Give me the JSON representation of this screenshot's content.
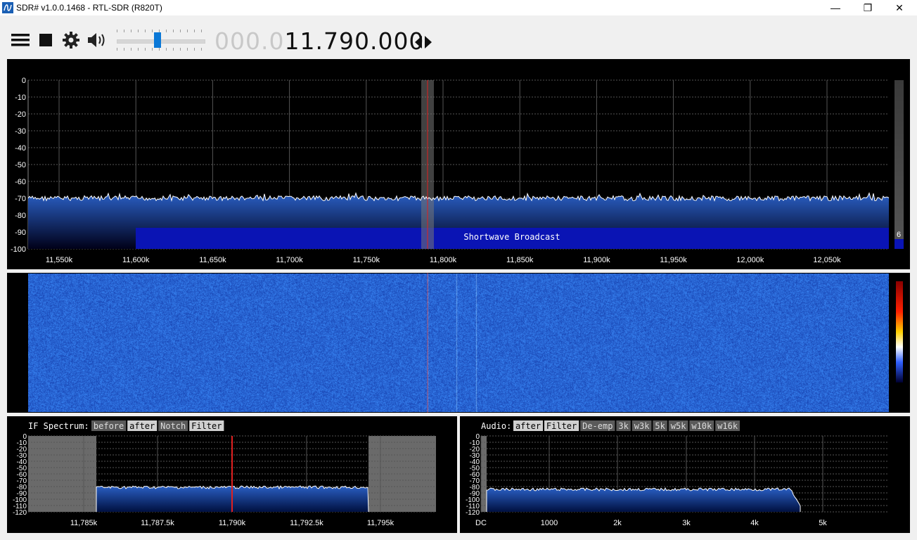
{
  "window": {
    "title": "SDR# v1.0.0.1468 - RTL-SDR (R820T)",
    "minimize": "—",
    "maximize": "❐",
    "close": "✕"
  },
  "toolbar": {
    "menu_icon": "hamburger-menu-icon",
    "stop_icon": "stop-square-icon",
    "settings_icon": "gear-icon",
    "audio_icon": "speaker-icon",
    "volume_level": 0.47,
    "freq_dim": "000.0",
    "freq_lit": "11.790.000",
    "tune_arrows_icon": "left-right-arrows-icon"
  },
  "spectrum": {
    "y_ticks": [
      "0",
      "-10",
      "-20",
      "-30",
      "-40",
      "-50",
      "-60",
      "-70",
      "-80",
      "-90",
      "-100"
    ],
    "x_ticks": [
      "11,550k",
      "11,600k",
      "11,650k",
      "11,700k",
      "11,750k",
      "11,800k",
      "11,850k",
      "11,900k",
      "11,950k",
      "12,000k",
      "12,050k"
    ],
    "band_label": "Shortwave Broadcast",
    "gain_value": "6",
    "noise_floor_db": -70
  },
  "if_spectrum": {
    "label": "IF Spectrum:",
    "buttons": [
      "before",
      "after",
      "Notch",
      "Filter"
    ],
    "y_ticks": [
      "0",
      "-10",
      "-20",
      "-30",
      "-40",
      "-50",
      "-60",
      "-70",
      "-80",
      "-90",
      "-100",
      "-110",
      "-120"
    ],
    "x_ticks": [
      "11,785k",
      "11,787.5k",
      "11,790k",
      "11,792.5k",
      "11,795k"
    ]
  },
  "audio": {
    "label": "Audio:",
    "buttons": [
      "after",
      "Filter",
      "De-emp",
      "3k",
      "w3k",
      "5k",
      "w5k",
      "w10k",
      "w16k"
    ],
    "y_ticks": [
      "0",
      "-10",
      "-20",
      "-30",
      "-40",
      "-50",
      "-60",
      "-70",
      "-80",
      "-90",
      "-100",
      "-110",
      "-120"
    ],
    "x_ticks": [
      "DC",
      "1000",
      "2k",
      "3k",
      "4k",
      "5k"
    ]
  },
  "colors": {
    "accent": "#0a78d7",
    "tuning_line": "#e02020",
    "band_fill": "#0a14b4",
    "waterfall_base": "#1e50c8"
  }
}
